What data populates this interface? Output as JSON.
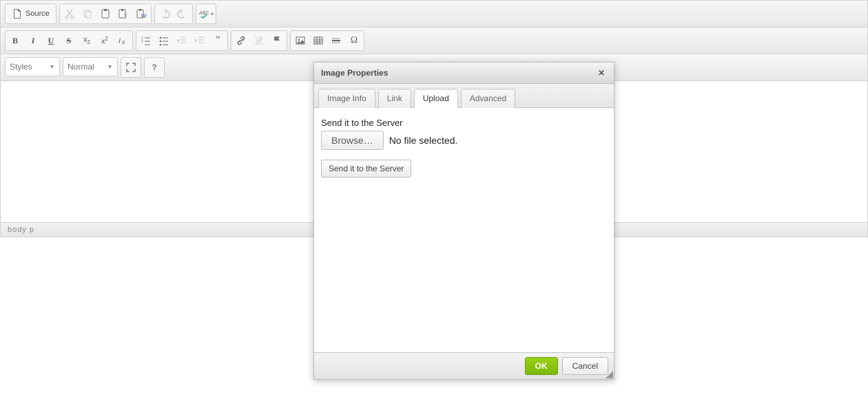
{
  "toolbar": {
    "source_label": "Source",
    "styles_label": "Styles",
    "format_label": "Normal"
  },
  "statusbar": {
    "path": "body  p"
  },
  "dialog": {
    "title": "Image Properties",
    "tabs": {
      "info": "Image Info",
      "link": "Link",
      "upload": "Upload",
      "advanced": "Advanced"
    },
    "upload": {
      "label": "Send it to the Server",
      "browse": "Browse…",
      "no_file": "No file selected.",
      "send": "Send it to the Server"
    },
    "footer": {
      "ok": "OK",
      "cancel": "Cancel"
    }
  }
}
